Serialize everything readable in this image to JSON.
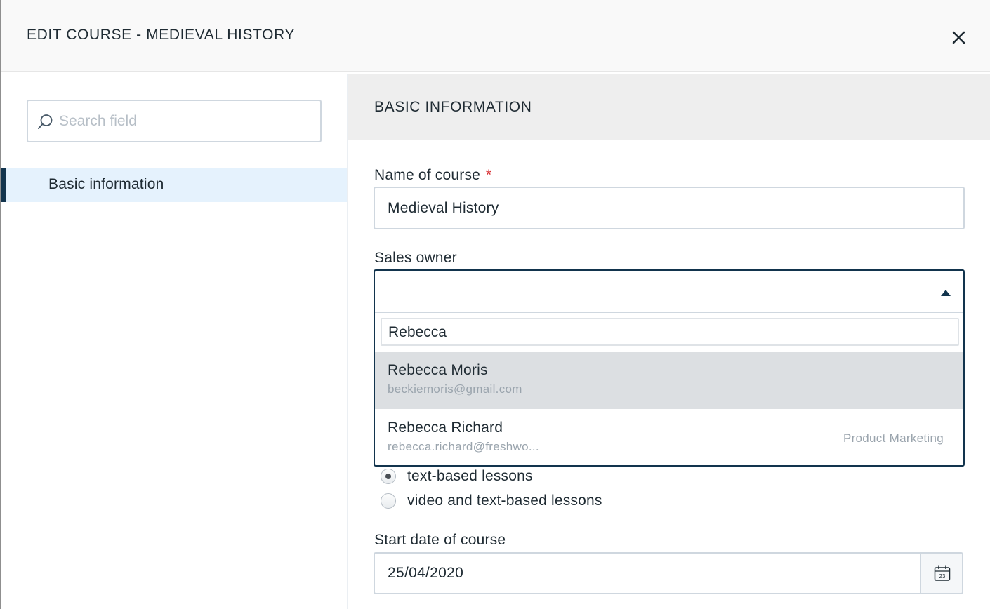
{
  "header": {
    "title": "EDIT COURSE - MEDIEVAL HISTORY"
  },
  "sidebar": {
    "search": {
      "placeholder": "Search field"
    },
    "items": [
      {
        "label": "Basic information",
        "selected": true
      }
    ]
  },
  "main": {
    "section_title": "BASIC INFORMATION",
    "course_name": {
      "label": "Name of course",
      "required_mark": "*",
      "value": "Medieval History"
    },
    "sales_owner": {
      "label": "Sales owner",
      "value": "",
      "search_query": "Rebecca",
      "options": [
        {
          "name": "Rebecca Moris",
          "email": "beckiemoris@gmail.com",
          "team": "",
          "highlighted": true
        },
        {
          "name": "Rebecca Richard",
          "email": "rebecca.richard@freshwo...",
          "team": "Product Marketing",
          "highlighted": false
        }
      ]
    },
    "lesson_type": {
      "options": [
        {
          "label": "text-based lessons",
          "checked": true
        },
        {
          "label": "video and text-based lessons",
          "checked": false
        }
      ]
    },
    "start_date": {
      "label": "Start date of course",
      "value": "25/04/2020"
    }
  },
  "icons": {
    "close": "close-icon",
    "search": "search-icon",
    "calendar": "calendar-icon"
  },
  "colors": {
    "accent": "#12344d",
    "required": "#d72d30",
    "selected_bg": "#e5f2fd",
    "highlight_bg": "#dcdfe2"
  }
}
